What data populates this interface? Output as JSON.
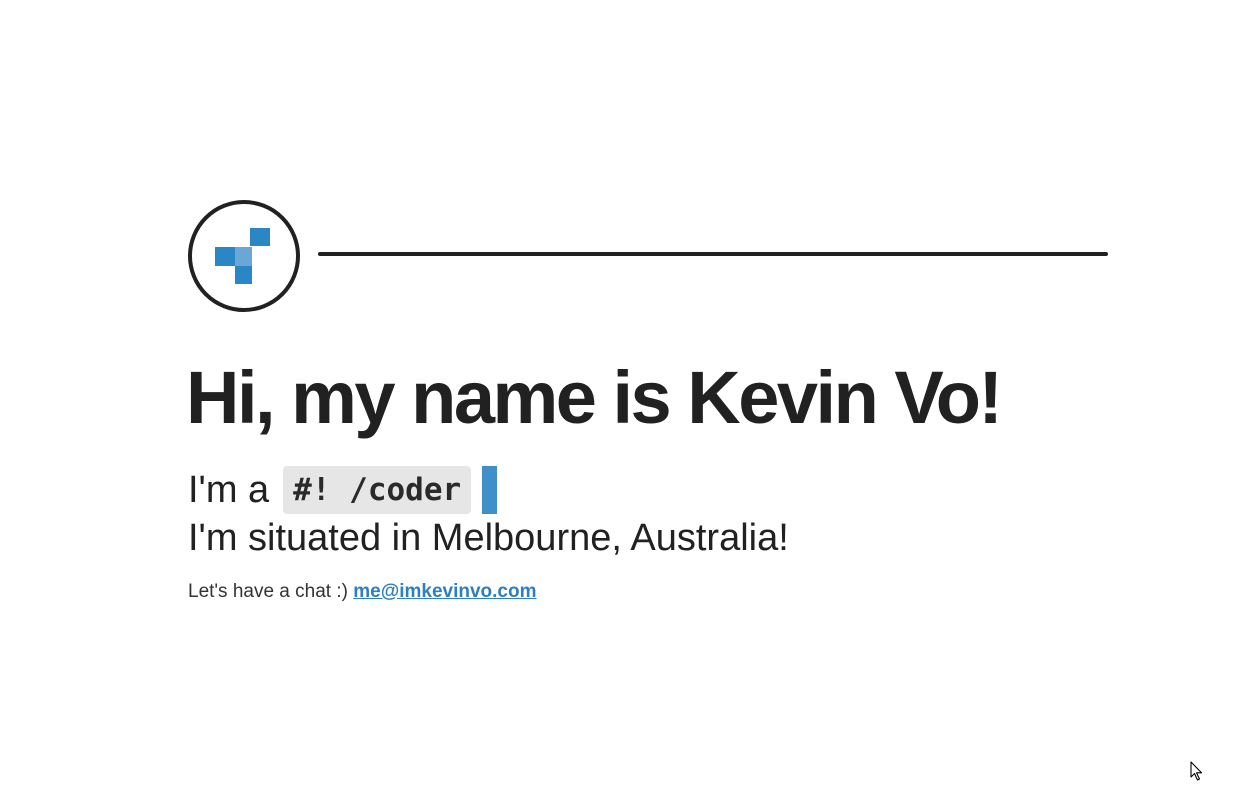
{
  "header": {
    "logo_icon": "kv-pixel-logo-icon"
  },
  "intro": {
    "headline": "Hi, my name is Kevin Vo!",
    "role_prefix": "I'm a",
    "role_code": "#! /coder",
    "location": "I'm situated in Melbourne, Australia!",
    "contact_prefix": "Let's have a chat :) ",
    "email": "me@imkevinvo.com"
  },
  "colors": {
    "text": "#212121",
    "accent": "#2e7fc1",
    "logo_blue": "#2a86c5",
    "logo_light_blue": "#6aa6d6",
    "code_background": "#e6e6e6",
    "typing_cursor": "#3f8fc8"
  },
  "cursor": {
    "icon": "mouse-pointer-icon"
  }
}
